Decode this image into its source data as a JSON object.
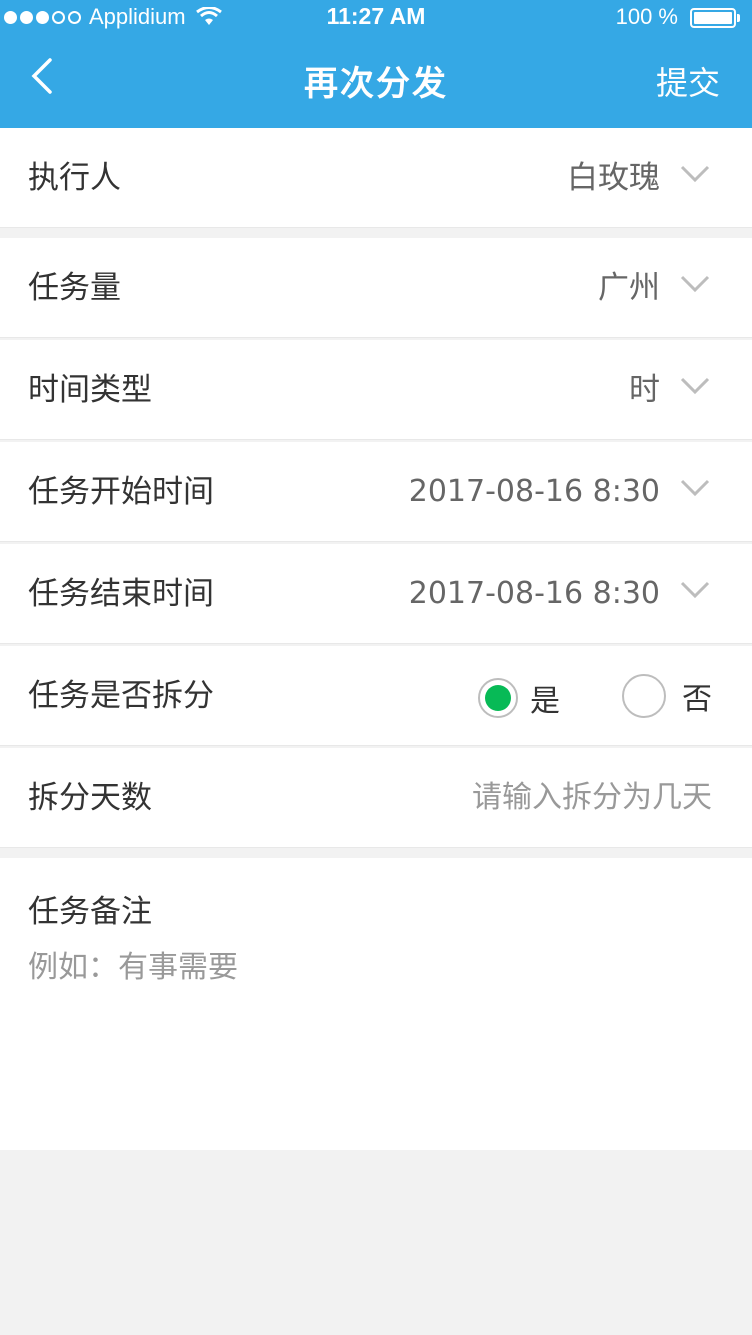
{
  "status_bar": {
    "carrier": "Applidium",
    "time": "11:27 AM",
    "battery": "100 %"
  },
  "nav": {
    "title": "再次分发",
    "submit": "提交"
  },
  "form": {
    "executor": {
      "label": "执行人",
      "value": "白玫瑰"
    },
    "task_amount": {
      "label": "任务量",
      "value": "广州"
    },
    "time_type": {
      "label": "时间类型",
      "value": "时"
    },
    "start_time": {
      "label": "任务开始时间",
      "value": "2017-08-16 8:30"
    },
    "end_time": {
      "label": "任务结束时间",
      "value": "2017-08-16 8:30"
    },
    "split": {
      "label": "任务是否拆分",
      "yes": "是",
      "no": "否",
      "selected": "是"
    },
    "split_days": {
      "label": "拆分天数",
      "placeholder": "请输入拆分为几天"
    },
    "notes": {
      "label": "任务备注",
      "placeholder": "例如：有事需要"
    }
  },
  "colors": {
    "header": "#35a8e5",
    "radio_on": "#07ba56",
    "label": "#333333",
    "value": "#666666",
    "hint": "#999999"
  },
  "icons": [
    "back-chevron-icon",
    "chevron-down-icon",
    "wifi-icon",
    "battery-icon"
  ]
}
